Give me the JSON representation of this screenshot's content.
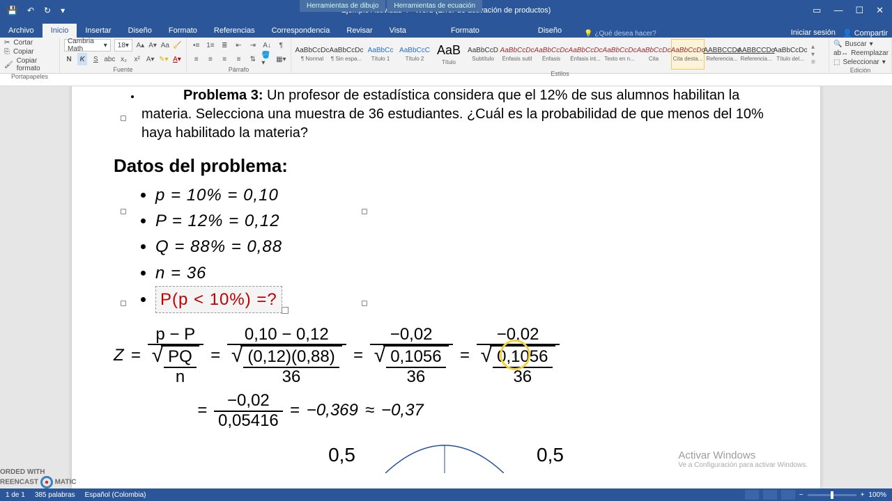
{
  "titlebar": {
    "title": "Ejemplo Actividad 4 - Word (Error de activación de productos)",
    "ctx1": "Herramientas de dibujo",
    "ctx2": "Herramientas de ecuación"
  },
  "tabs": {
    "archivo": "Archivo",
    "inicio": "Inicio",
    "insertar": "Insertar",
    "diseno": "Diseño",
    "formato": "Formato",
    "referencias": "Referencias",
    "correspondencia": "Correspondencia",
    "revisar": "Revisar",
    "vista": "Vista",
    "formato2": "Formato",
    "diseno2": "Diseño",
    "tellme": "¿Qué desea hacer?",
    "signin": "Iniciar sesión",
    "share": "Compartir"
  },
  "ribbon": {
    "clipboard": {
      "cut": "Cortar",
      "copy": "Copiar",
      "paint": "Copiar formato",
      "label": "Portapapeles"
    },
    "font": {
      "name": "Cambria Math",
      "size": "18",
      "label": "Fuente"
    },
    "para": {
      "label": "Párrafo"
    },
    "styles": {
      "items": [
        {
          "preview": "AaBbCcDc",
          "name": "¶ Normal"
        },
        {
          "preview": "AaBbCcDc",
          "name": "¶ Sin espa..."
        },
        {
          "preview": "AaBbCc",
          "name": "Título 1"
        },
        {
          "preview": "AaBbCcC",
          "name": "Título 2"
        },
        {
          "preview": "AaB",
          "name": "Título"
        },
        {
          "preview": "AaBbCcD",
          "name": "Subtítulo"
        },
        {
          "preview": "AaBbCcDc",
          "name": "Énfasis sutil"
        },
        {
          "preview": "AaBbCcDc",
          "name": "Énfasis"
        },
        {
          "preview": "AaBbCcDc",
          "name": "Énfasis int..."
        },
        {
          "preview": "AaBbCcDc",
          "name": "Texto en n..."
        },
        {
          "preview": "AaBbCcDc",
          "name": "Cita"
        },
        {
          "preview": "AaBbCcDc",
          "name": "Cita desta..."
        },
        {
          "preview": "AABBCCDc",
          "name": "Referencia..."
        },
        {
          "preview": "AABBCCDc",
          "name": "Referencia..."
        },
        {
          "preview": "AaBbCcDc",
          "name": "Título del..."
        }
      ],
      "label": "Estilos"
    },
    "editing": {
      "find": "Buscar",
      "replace": "Reemplazar",
      "select": "Seleccionar",
      "label": "Edición"
    }
  },
  "doc": {
    "problem_label": "Problema 3:",
    "problem_text": " Un profesor de estadística considera que el 12% de sus alumnos habilitan la materia. Selecciona una muestra de 36 estudiantes. ¿Cuál es la probabilidad de que menos del 10% haya habilitado la materia?",
    "datos_h": "Datos del problema:",
    "d1": "p = 10% = 0,10",
    "d2": "P = 12% = 0,12",
    "d3": "Q = 88% = 0,88",
    "d4": "n = 36",
    "d5": "P(p < 10%) =?",
    "z": "Z",
    "eq": "=",
    "pmP": "p − P",
    "PQ": "PQ",
    "n": "n",
    "n1": "0,10 − 0,12",
    "d1f": "(0,12)(0,88)",
    "d1n": "36",
    "n2": "−0,02",
    "d2f": "0,1056",
    "d2n": "36",
    "n3": "−0,02",
    "d3f": "0,1056",
    "d3n": "36",
    "n4": "−0,02",
    "d4f": "0,05416",
    "r1": "−0,369",
    "ap": "≈",
    "r2": "−0,37",
    "half_l": "0,5",
    "half_r": "0,5",
    "activate": "Activar Windows",
    "activate_sub": "Ve a Configuración para activar Windows."
  },
  "status": {
    "page": "1 de 1",
    "words": "385 palabras",
    "lang": "Español (Colombia)",
    "zoom": "100%"
  },
  "rec": {
    "t1": "ORDED WITH",
    "t2": "REENCAST",
    "t3": "MATIC"
  }
}
